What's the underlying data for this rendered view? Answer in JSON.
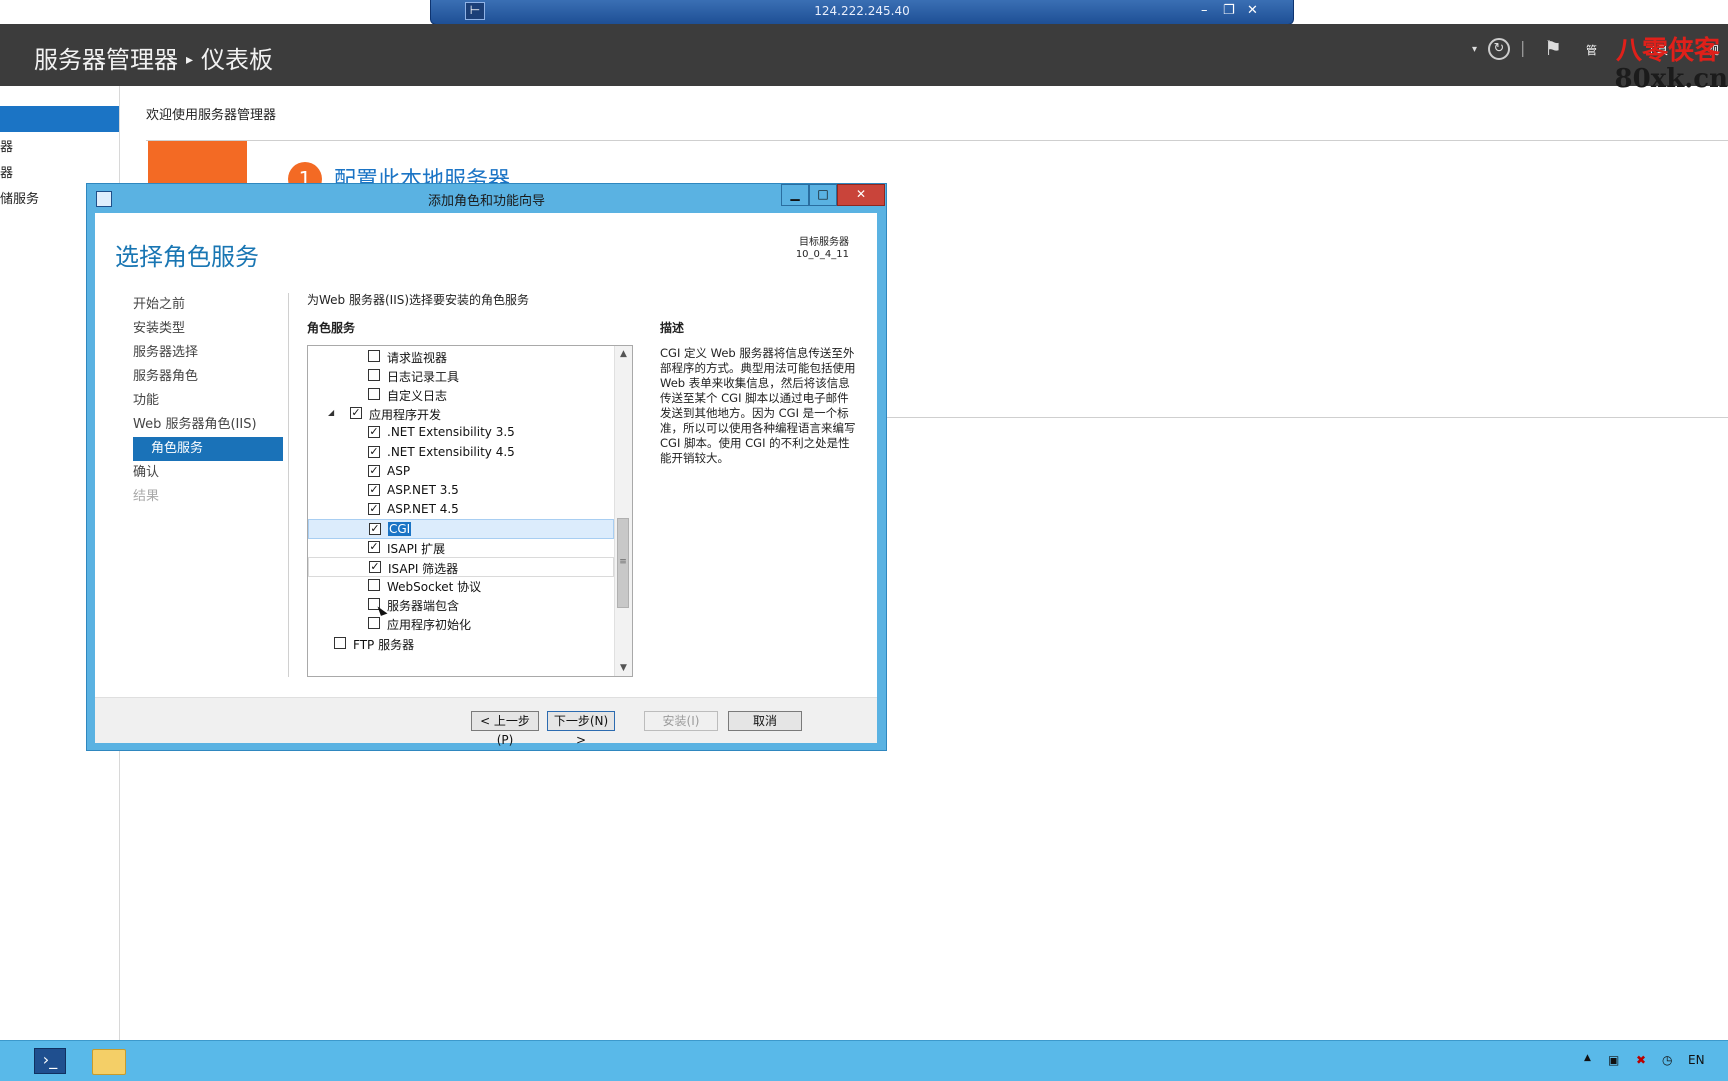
{
  "rdp": {
    "ip": "124.222.245.40",
    "pin": "⊢",
    "minimize": "–",
    "restore": "❐",
    "close": "✕"
  },
  "header": {
    "app": "服务器管理器",
    "page": "仪表板",
    "sep": "▸"
  },
  "watermark": {
    "line1": "八零侠客",
    "line2": "80xk.cn"
  },
  "header_menu": {
    "manage_partial": "管",
    "tools_partial": "工具",
    "view_partial": "视"
  },
  "sm_left": {
    "items": [
      "器",
      "器",
      "储服务"
    ]
  },
  "sm_main": {
    "welcome": "欢迎使用服务器管理器",
    "step_number": "1",
    "step_link": "配置此本地服务器"
  },
  "wizard": {
    "title": "添加角色和功能向导",
    "heading": "选择角色服务",
    "target_label": "目标服务器",
    "target_value": "10_0_4_11",
    "nav": [
      {
        "label": "开始之前",
        "state": "normal"
      },
      {
        "label": "安装类型",
        "state": "normal"
      },
      {
        "label": "服务器选择",
        "state": "normal"
      },
      {
        "label": "服务器角色",
        "state": "normal"
      },
      {
        "label": "功能",
        "state": "normal"
      },
      {
        "label": "Web 服务器角色(IIS)",
        "state": "normal"
      },
      {
        "label": "角色服务",
        "state": "active"
      },
      {
        "label": "确认",
        "state": "normal"
      },
      {
        "label": "结果",
        "state": "disabled"
      }
    ],
    "prompt": "为Web 服务器(IIS)选择要安装的角色服务",
    "col_head": "角色服务",
    "desc_head": "描述",
    "description": "CGI 定义 Web 服务器将信息传送至外部程序的方式。典型用法可能包括使用 Web 表单来收集信息，然后将该信息传送至某个 CGI 脚本以通过电子邮件发送到其他地方。因为 CGI 是一个标准，所以可以使用各种编程语言来编写 CGI 脚本。使用 CGI 的不利之处是性能开销较大。",
    "tree": [
      {
        "label": "请求监视器",
        "checked": false,
        "level": 2
      },
      {
        "label": "日志记录工具",
        "checked": false,
        "level": 2
      },
      {
        "label": "自定义日志",
        "checked": false,
        "level": 2
      },
      {
        "label": "应用程序开发",
        "checked": true,
        "level": 1,
        "expanded": true
      },
      {
        "label": ".NET Extensibility 3.5",
        "checked": true,
        "level": 2
      },
      {
        "label": ".NET Extensibility 4.5",
        "checked": true,
        "level": 2
      },
      {
        "label": "ASP",
        "checked": true,
        "level": 2
      },
      {
        "label": "ASP.NET 3.5",
        "checked": true,
        "level": 2
      },
      {
        "label": "ASP.NET 4.5",
        "checked": true,
        "level": 2
      },
      {
        "label": "CGI",
        "checked": true,
        "level": 2,
        "selected": true
      },
      {
        "label": "ISAPI 扩展",
        "checked": true,
        "level": 2
      },
      {
        "label": "ISAPI 筛选器",
        "checked": true,
        "level": 2,
        "hover": true
      },
      {
        "label": "WebSocket 协议",
        "checked": false,
        "level": 2
      },
      {
        "label": "服务器端包含",
        "checked": false,
        "level": 2
      },
      {
        "label": "应用程序初始化",
        "checked": false,
        "level": 2
      },
      {
        "label": "FTP 服务器",
        "checked": false,
        "level": 1
      }
    ],
    "buttons": {
      "prev": "< 上一步(P)",
      "next": "下一步(N) >",
      "install": "安装(I)",
      "cancel": "取消"
    }
  },
  "tray": {
    "lang": "EN"
  },
  "colors": {
    "accent": "#1b74c5",
    "orange": "#f36a24",
    "header_bg": "#3c3c3c",
    "taskbar": "#59b9e9"
  }
}
